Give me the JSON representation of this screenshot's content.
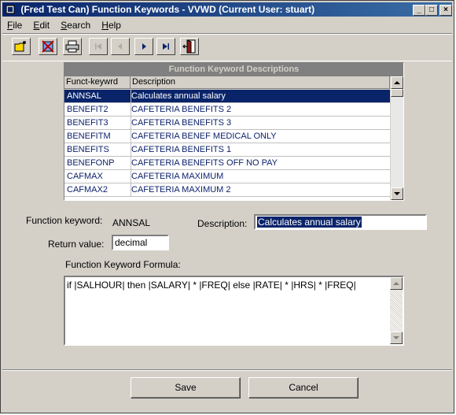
{
  "window": {
    "title": "(Fred Test Can) Function Keywords - VVWD (Current User: stuart)",
    "controls": {
      "minimize": "_",
      "maximize": "□",
      "close": "×"
    }
  },
  "menu": {
    "items": [
      {
        "label": "File",
        "accel": "F",
        "rest": "ile"
      },
      {
        "label": "Edit",
        "accel": "E",
        "rest": "dit"
      },
      {
        "label": "Search",
        "accel": "S",
        "rest": "earch"
      },
      {
        "label": "Help",
        "accel": "H",
        "rest": "elp"
      }
    ]
  },
  "toolbar": {
    "buttons": [
      {
        "icon": "new-folder-icon",
        "enabled": true
      },
      {
        "icon": "delete-icon",
        "enabled": true
      },
      {
        "icon": "print-icon",
        "enabled": true
      },
      {
        "icon": "first-record-icon",
        "enabled": false
      },
      {
        "icon": "previous-record-icon",
        "enabled": false
      },
      {
        "icon": "next-record-icon",
        "enabled": true
      },
      {
        "icon": "last-record-icon",
        "enabled": true
      },
      {
        "icon": "exit-door-icon",
        "enabled": true
      }
    ]
  },
  "grid": {
    "caption": "Function Keyword Descriptions",
    "columns": [
      "Funct-keywrd",
      "Description"
    ],
    "rows": [
      {
        "keyword": "ANNSAL",
        "description": "Calculates annual salary",
        "selected": true
      },
      {
        "keyword": "BENEFIT2",
        "description": "CAFETERIA BENEFITS 2",
        "selected": false
      },
      {
        "keyword": "BENEFIT3",
        "description": "CAFETERIA BENEFITS 3",
        "selected": false
      },
      {
        "keyword": "BENEFITM",
        "description": "CAFETERIA BENEF MEDICAL ONLY",
        "selected": false
      },
      {
        "keyword": "BENEFITS",
        "description": "CAFETERIA BENEFITS 1",
        "selected": false
      },
      {
        "keyword": "BENEFONP",
        "description": "CAFETERIA BENEFITS OFF NO PAY",
        "selected": false
      },
      {
        "keyword": "CAFMAX",
        "description": "CAFETERIA MAXIMUM",
        "selected": false
      },
      {
        "keyword": "CAFMAX2",
        "description": "CAFETERIA MAXIMUM 2",
        "selected": false
      }
    ]
  },
  "form": {
    "keyword_label": "Function keyword:",
    "keyword_value": "ANNSAL",
    "description_label": "Description:",
    "description_value": "Calculates annual salary",
    "return_label": "Return value:",
    "return_value": "decimal",
    "formula_label": "Function Keyword Formula:",
    "formula_value": "if |SALHOUR| then |SALARY| * |FREQ| else |RATE| * |HRS| * |FREQ|"
  },
  "buttons": {
    "save": "Save",
    "cancel": "Cancel"
  },
  "colors": {
    "title_bar": "#0a246a",
    "selection": "#0a246a",
    "face": "#d4d0c8",
    "grid_text": "#0a1f6a"
  }
}
